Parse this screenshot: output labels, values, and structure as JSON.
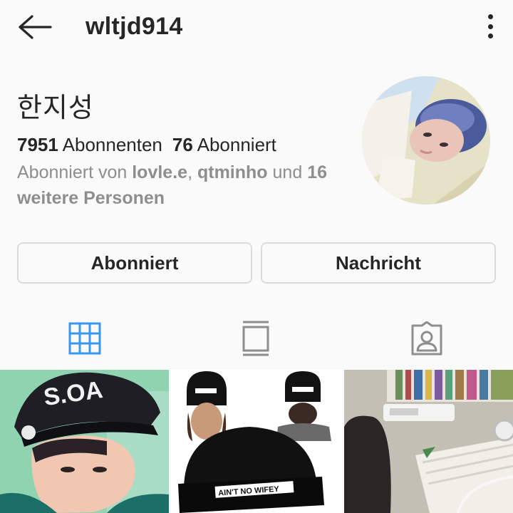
{
  "header": {
    "username": "wltjd914",
    "back_icon": "arrow-left-icon",
    "more_icon": "more-vertical-icon"
  },
  "profile": {
    "display_name": "한지성",
    "followers_count": "7951",
    "followers_label": "Abonnenten",
    "following_count": "76",
    "following_label": "Abonniert",
    "followed_by_prefix": "Abonniert von",
    "followed_by_user1": "lovle.e",
    "followed_by_sep": ",",
    "followed_by_user2": "qtminho",
    "followed_by_and": "und",
    "followed_by_others": "16 weitere Personen"
  },
  "actions": {
    "follow_label": "Abonniert",
    "message_label": "Nachricht"
  },
  "tabs": [
    {
      "icon": "grid-icon",
      "active": true,
      "color": "#3897f0"
    },
    {
      "icon": "list-icon",
      "active": false,
      "color": "#8e8e8e"
    },
    {
      "icon": "tagged-icon",
      "active": false,
      "color": "#8e8e8e"
    }
  ],
  "posts": [
    {
      "cap_text": "S.OA"
    },
    {
      "beanie_text": "AIN'T NO WIFEY"
    },
    {}
  ],
  "colors": {
    "text": "#262626",
    "muted": "#8e8e8e",
    "accent": "#3897f0",
    "border": "#dbdbdb"
  }
}
